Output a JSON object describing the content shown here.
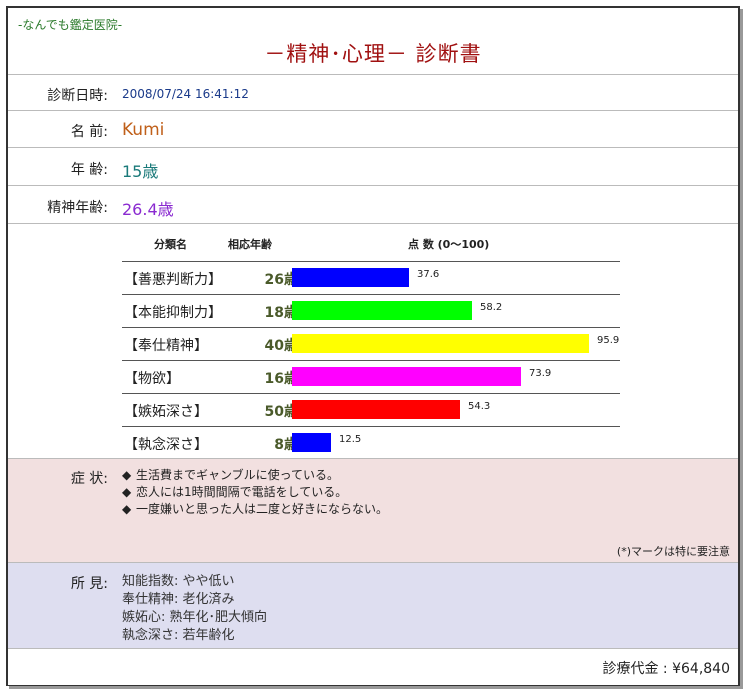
{
  "header": {
    "clinic": "-なんでも鑑定医院-",
    "title": "－精神･心理－ 診断書"
  },
  "fields": {
    "date_label": "診断日時:",
    "date_value": "2008/07/24 16:41:12",
    "name_label": "名 前:",
    "name_value": "Kumi",
    "age_label": "年 齢:",
    "age_value": "15歳",
    "mental_age_label": "精神年齢:",
    "mental_age_value": "26.4歳"
  },
  "chart_data": {
    "type": "bar",
    "headers": [
      "分類名",
      "相応年齢",
      "点 数 (0～100)"
    ],
    "categories": [
      "【善悪判断力】",
      "【本能抑制力】",
      "【奉仕精神】",
      "【物欲】",
      "【嫉妬深さ】",
      "【執念深さ】"
    ],
    "ages": [
      "26歳",
      "18歳",
      "40歳",
      "16歳",
      "50歳",
      "8歳"
    ],
    "values": [
      37.6,
      58.2,
      95.9,
      73.9,
      54.3,
      12.5
    ],
    "colors": [
      "#0000ff",
      "#00ff00",
      "#ffff00",
      "#ff00ff",
      "#ff0000",
      "#0000ff"
    ],
    "ylim": [
      0,
      100
    ]
  },
  "symptoms": {
    "label": "症 状:",
    "items": [
      "生活費までギャンブルに使っている。",
      "恋人には1時間間隔で電話をしている。",
      "一度嫌いと思った人は二度と好きにならない。"
    ],
    "bullet": "◆",
    "note": "(*)マークは特に要注意"
  },
  "findings": {
    "label": "所 見:",
    "items": [
      "知能指数: やや低い",
      "奉仕精神: 老化済み",
      "嫉妬心: 熟年化･肥大傾向",
      "執念深さ: 若年齢化"
    ]
  },
  "fee": {
    "text": "診療代金 : ¥64,840"
  }
}
